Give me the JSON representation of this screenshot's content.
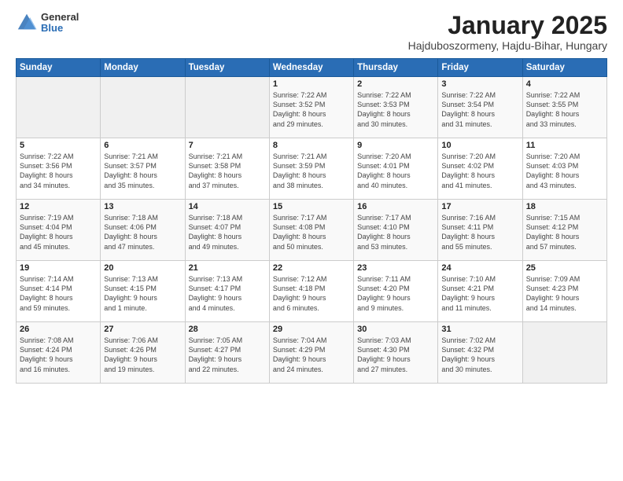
{
  "header": {
    "logo_general": "General",
    "logo_blue": "Blue",
    "month_title": "January 2025",
    "location": "Hajduboszormeny, Hajdu-Bihar, Hungary"
  },
  "days_of_week": [
    "Sunday",
    "Monday",
    "Tuesday",
    "Wednesday",
    "Thursday",
    "Friday",
    "Saturday"
  ],
  "weeks": [
    [
      {
        "day": "",
        "info": ""
      },
      {
        "day": "",
        "info": ""
      },
      {
        "day": "",
        "info": ""
      },
      {
        "day": "1",
        "info": "Sunrise: 7:22 AM\nSunset: 3:52 PM\nDaylight: 8 hours\nand 29 minutes."
      },
      {
        "day": "2",
        "info": "Sunrise: 7:22 AM\nSunset: 3:53 PM\nDaylight: 8 hours\nand 30 minutes."
      },
      {
        "day": "3",
        "info": "Sunrise: 7:22 AM\nSunset: 3:54 PM\nDaylight: 8 hours\nand 31 minutes."
      },
      {
        "day": "4",
        "info": "Sunrise: 7:22 AM\nSunset: 3:55 PM\nDaylight: 8 hours\nand 33 minutes."
      }
    ],
    [
      {
        "day": "5",
        "info": "Sunrise: 7:22 AM\nSunset: 3:56 PM\nDaylight: 8 hours\nand 34 minutes."
      },
      {
        "day": "6",
        "info": "Sunrise: 7:21 AM\nSunset: 3:57 PM\nDaylight: 8 hours\nand 35 minutes."
      },
      {
        "day": "7",
        "info": "Sunrise: 7:21 AM\nSunset: 3:58 PM\nDaylight: 8 hours\nand 37 minutes."
      },
      {
        "day": "8",
        "info": "Sunrise: 7:21 AM\nSunset: 3:59 PM\nDaylight: 8 hours\nand 38 minutes."
      },
      {
        "day": "9",
        "info": "Sunrise: 7:20 AM\nSunset: 4:01 PM\nDaylight: 8 hours\nand 40 minutes."
      },
      {
        "day": "10",
        "info": "Sunrise: 7:20 AM\nSunset: 4:02 PM\nDaylight: 8 hours\nand 41 minutes."
      },
      {
        "day": "11",
        "info": "Sunrise: 7:20 AM\nSunset: 4:03 PM\nDaylight: 8 hours\nand 43 minutes."
      }
    ],
    [
      {
        "day": "12",
        "info": "Sunrise: 7:19 AM\nSunset: 4:04 PM\nDaylight: 8 hours\nand 45 minutes."
      },
      {
        "day": "13",
        "info": "Sunrise: 7:18 AM\nSunset: 4:06 PM\nDaylight: 8 hours\nand 47 minutes."
      },
      {
        "day": "14",
        "info": "Sunrise: 7:18 AM\nSunset: 4:07 PM\nDaylight: 8 hours\nand 49 minutes."
      },
      {
        "day": "15",
        "info": "Sunrise: 7:17 AM\nSunset: 4:08 PM\nDaylight: 8 hours\nand 50 minutes."
      },
      {
        "day": "16",
        "info": "Sunrise: 7:17 AM\nSunset: 4:10 PM\nDaylight: 8 hours\nand 53 minutes."
      },
      {
        "day": "17",
        "info": "Sunrise: 7:16 AM\nSunset: 4:11 PM\nDaylight: 8 hours\nand 55 minutes."
      },
      {
        "day": "18",
        "info": "Sunrise: 7:15 AM\nSunset: 4:12 PM\nDaylight: 8 hours\nand 57 minutes."
      }
    ],
    [
      {
        "day": "19",
        "info": "Sunrise: 7:14 AM\nSunset: 4:14 PM\nDaylight: 8 hours\nand 59 minutes."
      },
      {
        "day": "20",
        "info": "Sunrise: 7:13 AM\nSunset: 4:15 PM\nDaylight: 9 hours\nand 1 minute."
      },
      {
        "day": "21",
        "info": "Sunrise: 7:13 AM\nSunset: 4:17 PM\nDaylight: 9 hours\nand 4 minutes."
      },
      {
        "day": "22",
        "info": "Sunrise: 7:12 AM\nSunset: 4:18 PM\nDaylight: 9 hours\nand 6 minutes."
      },
      {
        "day": "23",
        "info": "Sunrise: 7:11 AM\nSunset: 4:20 PM\nDaylight: 9 hours\nand 9 minutes."
      },
      {
        "day": "24",
        "info": "Sunrise: 7:10 AM\nSunset: 4:21 PM\nDaylight: 9 hours\nand 11 minutes."
      },
      {
        "day": "25",
        "info": "Sunrise: 7:09 AM\nSunset: 4:23 PM\nDaylight: 9 hours\nand 14 minutes."
      }
    ],
    [
      {
        "day": "26",
        "info": "Sunrise: 7:08 AM\nSunset: 4:24 PM\nDaylight: 9 hours\nand 16 minutes."
      },
      {
        "day": "27",
        "info": "Sunrise: 7:06 AM\nSunset: 4:26 PM\nDaylight: 9 hours\nand 19 minutes."
      },
      {
        "day": "28",
        "info": "Sunrise: 7:05 AM\nSunset: 4:27 PM\nDaylight: 9 hours\nand 22 minutes."
      },
      {
        "day": "29",
        "info": "Sunrise: 7:04 AM\nSunset: 4:29 PM\nDaylight: 9 hours\nand 24 minutes."
      },
      {
        "day": "30",
        "info": "Sunrise: 7:03 AM\nSunset: 4:30 PM\nDaylight: 9 hours\nand 27 minutes."
      },
      {
        "day": "31",
        "info": "Sunrise: 7:02 AM\nSunset: 4:32 PM\nDaylight: 9 hours\nand 30 minutes."
      },
      {
        "day": "",
        "info": ""
      }
    ]
  ]
}
